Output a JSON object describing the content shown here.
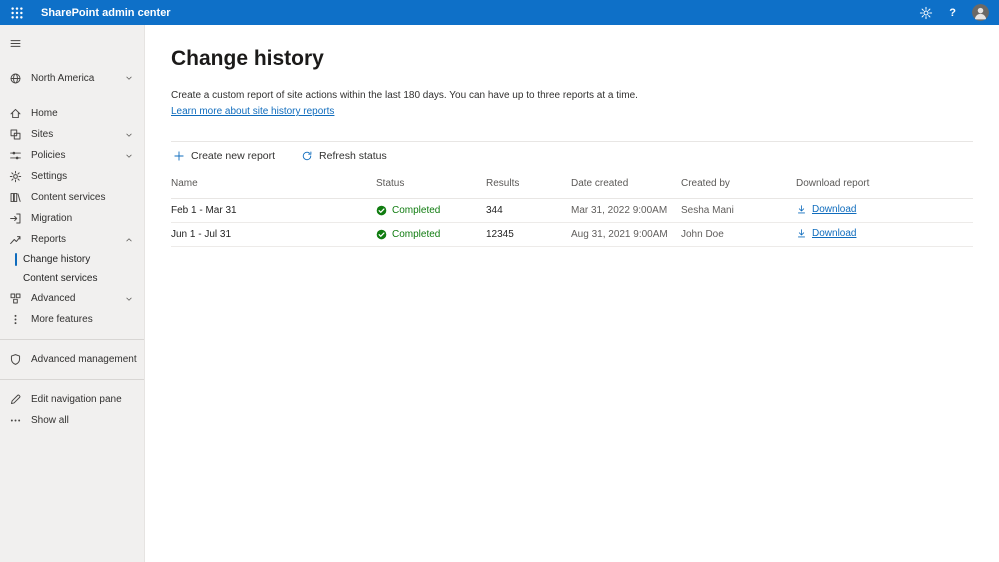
{
  "colors": {
    "topbar": "#0e70c8",
    "accent": "#0f6cbd",
    "success": "#107c10",
    "sidebar-bg": "#f1f0ef"
  },
  "topbar": {
    "title": "SharePoint admin center",
    "help_label": "?"
  },
  "sidebar": {
    "region": "North America",
    "items": [
      {
        "label": "Home"
      },
      {
        "label": "Sites"
      },
      {
        "label": "Policies"
      },
      {
        "label": "Settings"
      },
      {
        "label": "Content services"
      },
      {
        "label": "Migration"
      },
      {
        "label": "Reports"
      },
      {
        "label": "Advanced"
      },
      {
        "label": "More features"
      }
    ],
    "reports_children": [
      {
        "label": "Change history"
      },
      {
        "label": "Content services"
      }
    ],
    "advanced_management": "Advanced management",
    "edit_nav": "Edit navigation pane",
    "show_all": "Show all"
  },
  "main": {
    "title": "Change history",
    "description": "Create a custom report of site actions within the last 180 days. You can have up to three reports at a time.",
    "learn_more": "Learn more about site history reports",
    "toolbar": {
      "create": "Create new report",
      "refresh": "Refresh status"
    },
    "table": {
      "headers": [
        "Name",
        "Status",
        "Results",
        "Date created",
        "Created by",
        "Download report"
      ],
      "rows": [
        {
          "name": "Feb 1 - Mar 31",
          "status": "Completed",
          "results": "344",
          "date_created": "Mar 31, 2022 9:00AM",
          "created_by": "Sesha Mani",
          "download": "Download"
        },
        {
          "name": "Jun 1 - Jul 31",
          "status": "Completed",
          "results": "12345",
          "date_created": "Aug 31, 2021 9:00AM",
          "created_by": "John Doe",
          "download": "Download"
        }
      ]
    }
  }
}
